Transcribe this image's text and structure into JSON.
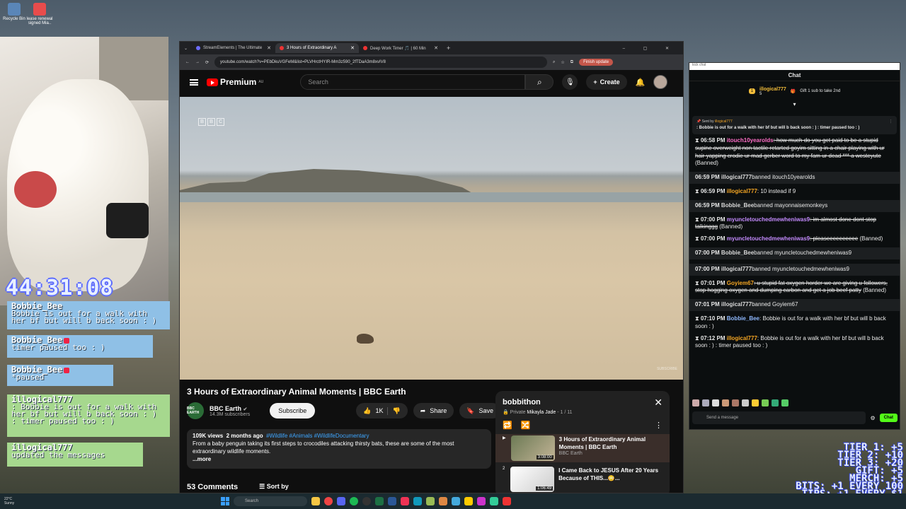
{
  "desktop": {
    "icons": [
      {
        "label": "Recycle Bin",
        "color": "#5a86b8"
      },
      {
        "label": "lease renewal signed Mia..",
        "color": "#e84c4c"
      }
    ]
  },
  "overlay": {
    "timer": "44:31:08",
    "messages": [
      {
        "user": "Bobbie_Bee",
        "text": "Bobbie is out for a walk with her bf but will b back soon : )"
      },
      {
        "user": "Bobbie_Bee",
        "text": "timer paused too : )"
      },
      {
        "user": "Bobbie_Bee",
        "text": "*paused"
      },
      {
        "user": "illogical777",
        "text": ": Bobbie is out for a walk with her bf but will b back soon : ) : timer paused too : )"
      },
      {
        "user": "illogical777",
        "text": "updated the messages"
      }
    ],
    "tiers": [
      "TIER 1: +5",
      "TIER 2: +10",
      "TIER 3: +20",
      "GIFT: +5",
      "MERCH: +5",
      "BITS: +1 EVERY 100",
      "TIPS: +1 EVERY $1"
    ]
  },
  "browser": {
    "tabs": [
      {
        "label": "StreamElements | The Ultimate",
        "active": false
      },
      {
        "label": "3 Hours of Extraordinary A",
        "active": true
      },
      {
        "label": "Deep Work Timer 🎵 | 60 Min",
        "active": false
      }
    ],
    "url": "youtube.com/watch?v=PEbDkuVGFeM&list=PLVHrctHYIR-Mm3z590_2fTDaA3m8xvIV8",
    "finish_update": "Finish update"
  },
  "youtube": {
    "logo": "Premium",
    "region": "AU",
    "search_placeholder": "Search",
    "create_label": "Create",
    "video": {
      "watermark_letters": [
        "B",
        "B",
        "C"
      ],
      "subscribe_watermark": "SUBSCRIBE",
      "title": "3 Hours of Extraordinary Animal Moments | BBC Earth",
      "channel": "BBC Earth",
      "channel_avatar_text": "BBC EARTH",
      "subscribers": "14.3M subscribers",
      "subscribe_label": "Subscribe",
      "likes": "1K",
      "share_label": "Share",
      "save_label": "Save",
      "views": "109K views",
      "age": "2 months ago",
      "tags": "#Wildlife #Animals #WildlifeDocumentary",
      "description": "From a baby penguin taking its first steps to crocodiles attacking thirsty bats, these are some of the most extraordinary wildlife moments.",
      "more": "...more",
      "comments_count": "53 Comments",
      "sort_label": "Sort by"
    },
    "playlist": {
      "title": "bobbithon",
      "privacy": "Private",
      "owner": "Mikayla Jade",
      "position": "1 / 11",
      "items": [
        {
          "index": "▶",
          "title": "3 Hours of Extraordinary Animal Moments | BBC Earth",
          "channel": "BBC Earth",
          "duration": "3:08:00"
        },
        {
          "index": "2",
          "title": "I Came Back to JESUS After 20 Years Because of THIS...😳...",
          "channel": "",
          "duration": "1:06:49"
        }
      ]
    }
  },
  "chat": {
    "window_title": "kick chat",
    "header": "Chat",
    "gift": {
      "user": "illogical777",
      "count": "5",
      "text": "Gift 1 sub to take 2nd"
    },
    "pinned": {
      "sent_by": "Sent by",
      "user": "illogical777",
      "text": ": Bobbie is out for a walk with her bf but will b back soon : ) : timer paused too : )"
    },
    "messages": [
      {
        "time": "06:58 PM",
        "user": "itouch10yearolds",
        "user_color": "#ff6ec7",
        "text": ": how much do you get paid to be a stupid supine overweight non tactile retarted goyim sitting in a chair playing with ur hair yapping crodie ur mad gerber word to my fam ur dead *** a westeyute",
        "banned": "(Banned)",
        "strike": true,
        "sys": false
      },
      {
        "time": "06:59 PM",
        "user": "illogical777",
        "user_color": "#d8d8d8",
        "text": "banned itouch10yearolds",
        "banned": "",
        "strike": false,
        "sys": true
      },
      {
        "time": "06:59 PM",
        "user": "illogical777",
        "user_color": "#f5a623",
        "text": ": 10 instead if 9",
        "banned": "",
        "strike": false,
        "sys": false
      },
      {
        "time": "06:59 PM",
        "user": "Bobbie_Bee",
        "user_color": "#d8d8d8",
        "text": "banned mayonnaisemonkeys",
        "banned": "",
        "strike": false,
        "sys": true
      },
      {
        "time": "07:00 PM",
        "user": "myuncletouchedmewheniwas9",
        "user_color": "#c48bff",
        "text": ": im almost done dont stop talkinggg",
        "banned": "(Banned)",
        "strike": true,
        "sys": false
      },
      {
        "time": "07:00 PM",
        "user": "myuncletouchedmewheniwas9",
        "user_color": "#c48bff",
        "text": ": pleaseeeeeeeeee",
        "banned": "(Banned)",
        "strike": true,
        "sys": false
      },
      {
        "time": "07:00 PM",
        "user": "Bobbie_Bee",
        "user_color": "#d8d8d8",
        "text": "banned myuncletouchedmewheniwas9",
        "banned": "",
        "strike": false,
        "sys": true
      },
      {
        "time": "07:00 PM",
        "user": "illogical777",
        "user_color": "#d8d8d8",
        "text": "banned myuncletouchedmewheniwas9",
        "banned": "",
        "strike": false,
        "sys": true
      },
      {
        "time": "07:01 PM",
        "user": "Goyiem67",
        "user_color": "#f5a623",
        "text": ": u stupid fat oxygen horder we are giving u followers, stop hogging oxygen and dumping carbon and get a job beef patty",
        "banned": "(Banned)",
        "strike": true,
        "sys": false
      },
      {
        "time": "07:01 PM",
        "user": "illogical777",
        "user_color": "#d8d8d8",
        "text": "banned Goyiem67",
        "banned": "",
        "strike": false,
        "sys": true
      },
      {
        "time": "07:10 PM",
        "user": "Bobbie_Bee",
        "user_color": "#8fb8ff",
        "text": ": Bobbie is out for a walk with her bf but will b back soon : )",
        "banned": "",
        "strike": false,
        "sys": false
      },
      {
        "time": "07:12 PM",
        "user": "illogical777",
        "user_color": "#f5a623",
        "text": ": Bobbie is out for a walk with her bf but will b back soon : ) : timer paused too : )",
        "banned": "",
        "strike": false,
        "sys": false
      }
    ],
    "input_placeholder": "Send a message",
    "send_label": "Chat"
  },
  "taskbar": {
    "weather_temp": "22°C",
    "weather_desc": "Sunny",
    "search_placeholder": "Search"
  },
  "colors": {
    "accent_red": "#ff0000",
    "kick_green": "#53fc18"
  }
}
